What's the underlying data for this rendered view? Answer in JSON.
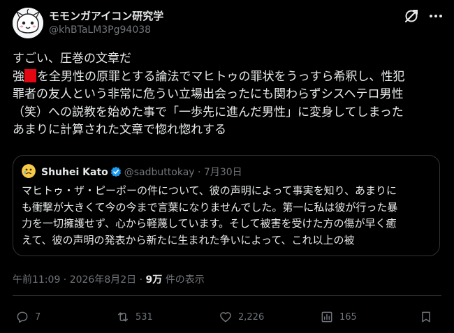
{
  "author": {
    "display_name": "モモンガアイコン研究学",
    "handle": "@khBTaLM3Pg94038"
  },
  "tweet": {
    "lines": [
      "すごい、圧巻の文章だ",
      "を全男性の原罪とする論法でマヒトゥの罪状をうっすら希釈し、性犯",
      "罪者の友人という非常に危うい立場出会ったにも関わらずシスヘテロ男性",
      "（笑）への説教を始めた事で「一歩先に進んだ男性」に変身してしまった",
      "あまりに計算された文章で惚れ惚れする"
    ],
    "line2_prefix": "強"
  },
  "quote": {
    "name": "Shuhei Kato",
    "handle": "@sadbuttokay",
    "separator": "·",
    "date": "7月30日",
    "lines": [
      "マヒトゥ・ザ・ピーポーの件について、彼の声明によって事実を知り、あまりに",
      "も衝撃が大きくて今の今まで言葉になりませんでした。第一に私は彼が行った暴",
      "力を一切擁護せず、心から軽蔑しています。そして被害を受けた方の傷が早く癒",
      "えて、彼の声明の発表から新たに生まれた争いによって、これ以上の被"
    ]
  },
  "meta": {
    "time_date": "午前11:09 · 2026年8月2日 · ",
    "views_count": "9万",
    "views_label": " 件の表示"
  },
  "actions": {
    "replies": "7",
    "reposts": "531",
    "likes": "2,226",
    "views": "165"
  },
  "colors": {
    "background": "#000000",
    "text": "#e7e9ea",
    "muted": "#71767b",
    "border": "#2f3336",
    "redaction": "#e30613",
    "verified": "#1d9bf0"
  },
  "icons": [
    "grok-icon",
    "more-icon",
    "verified-badge-icon",
    "reply-icon",
    "repost-icon",
    "like-icon",
    "views-icon",
    "bookmark-icon"
  ]
}
